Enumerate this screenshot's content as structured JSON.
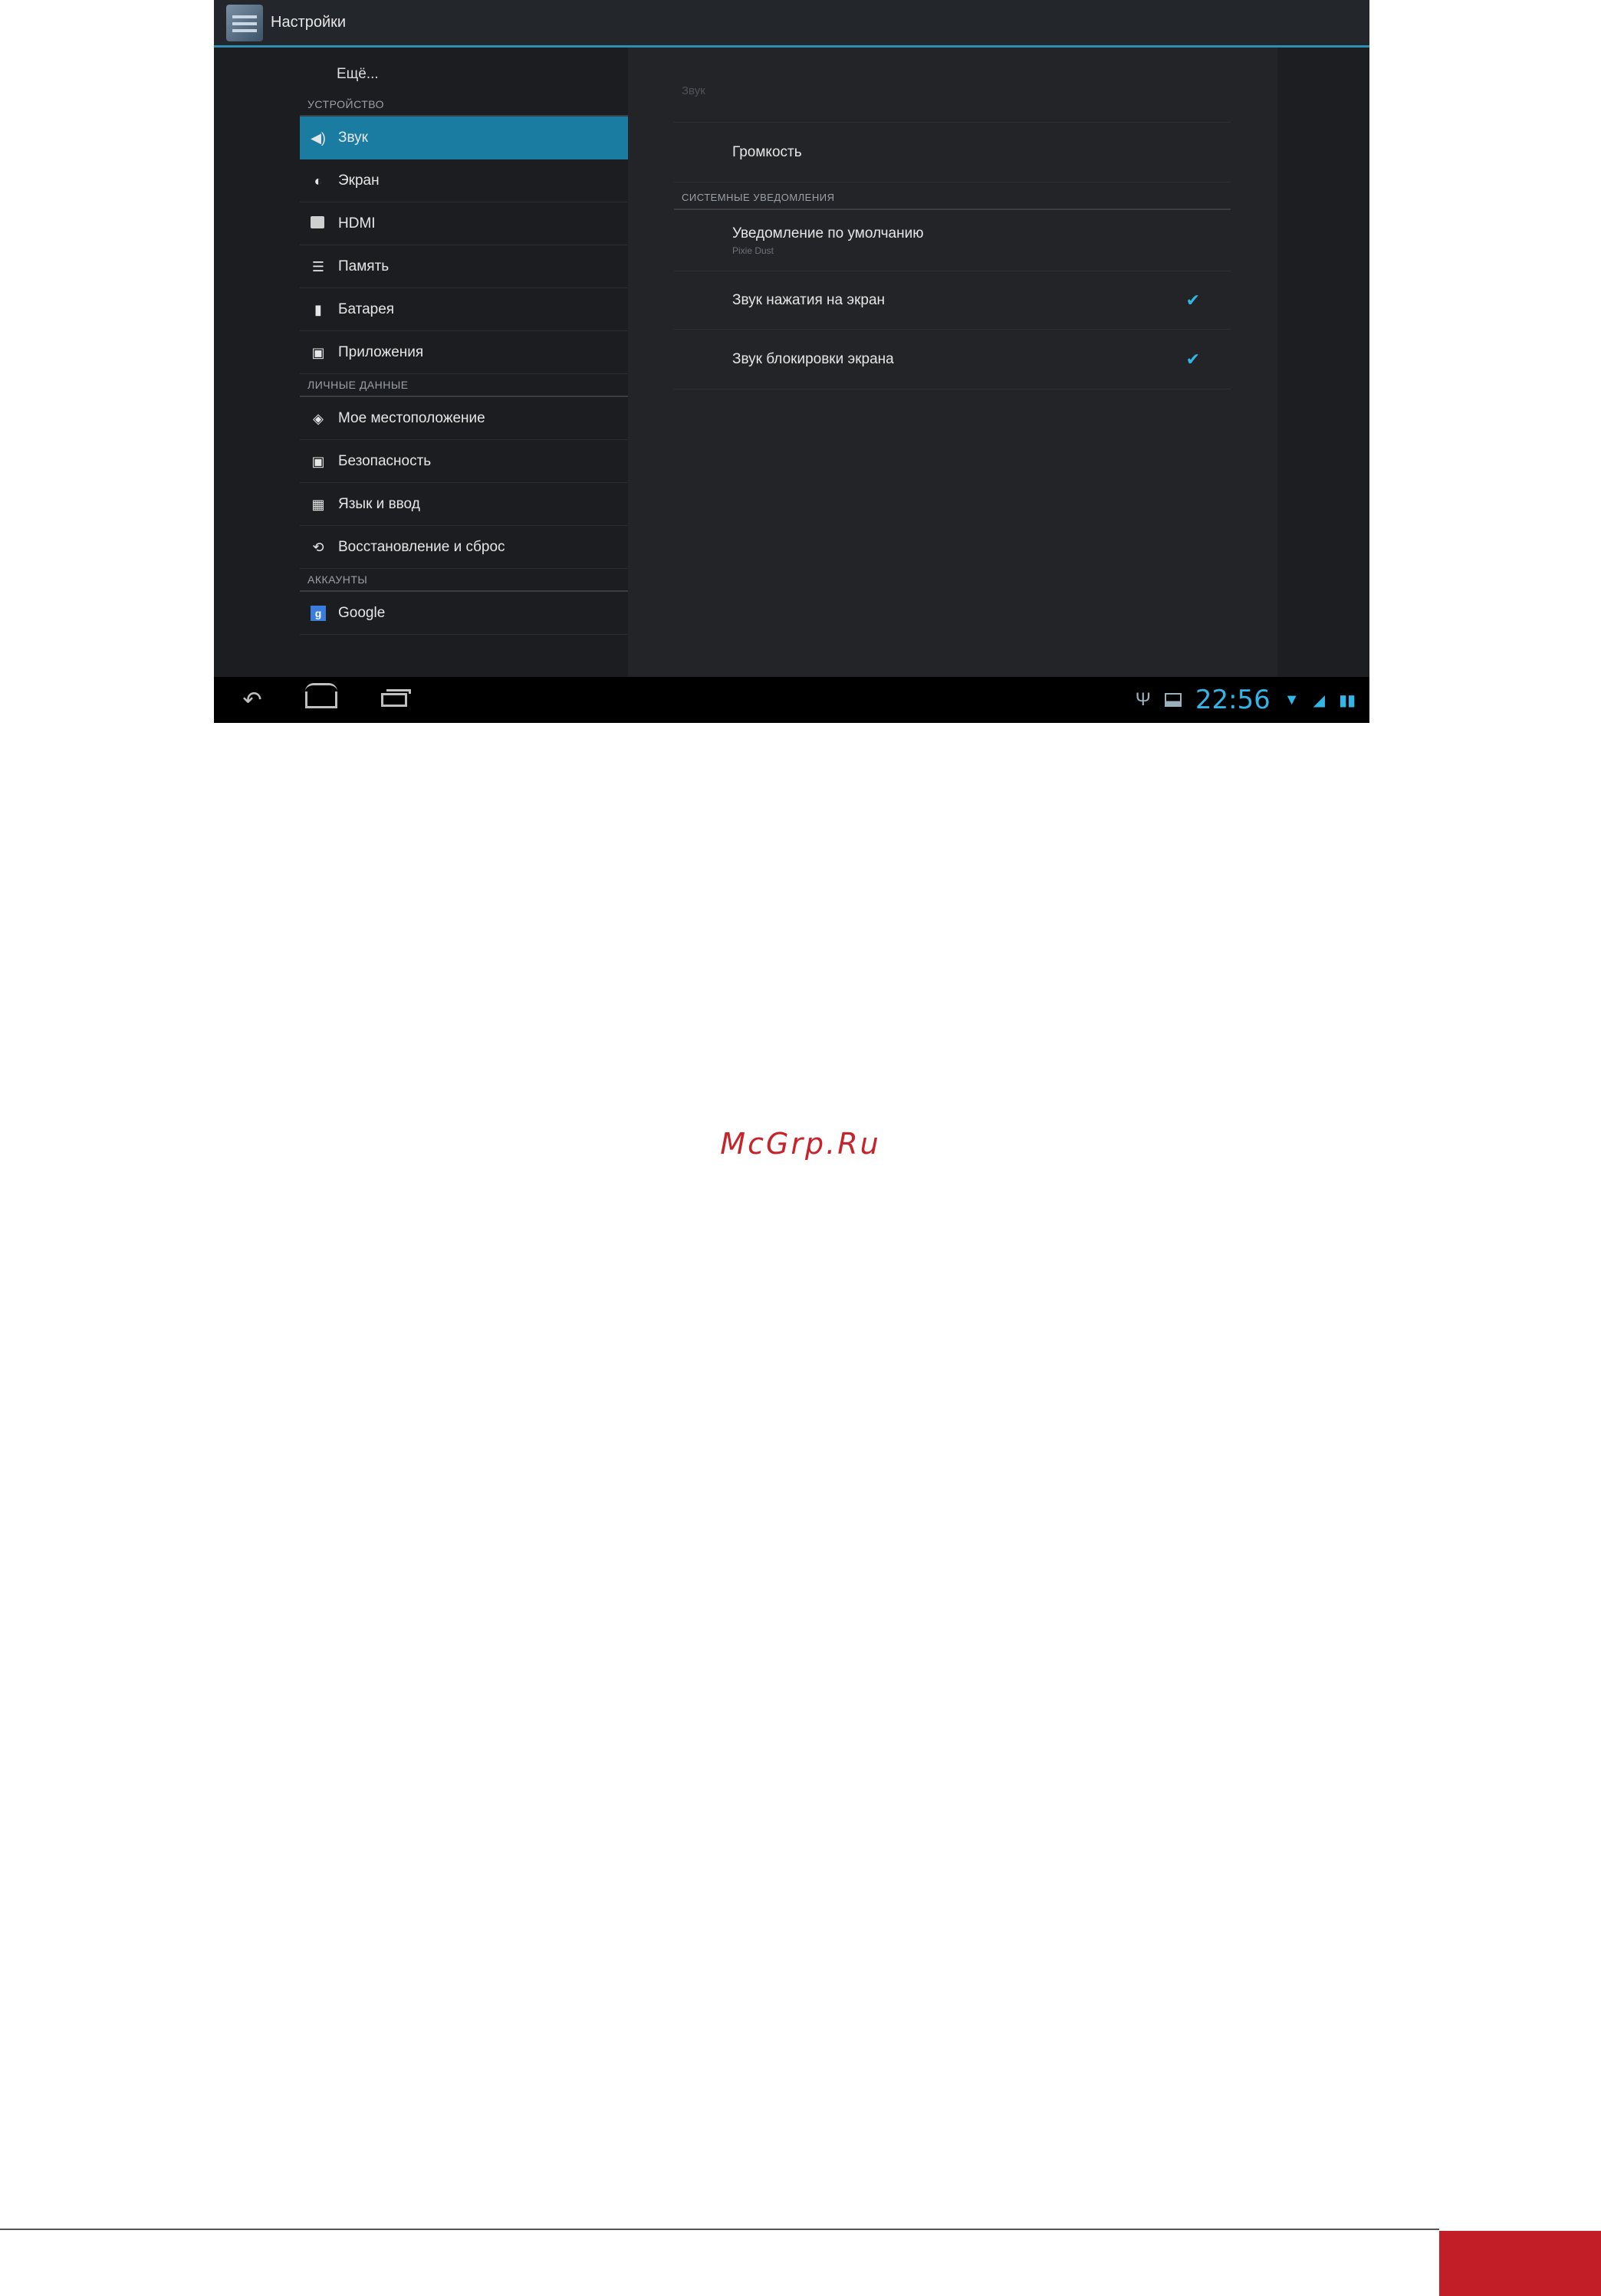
{
  "app_title": "Настройки",
  "left": {
    "more": "Ещё...",
    "section_device": "УСТРОЙСТВО",
    "items_device": [
      {
        "label": "Звук",
        "icon": "speaker-icon"
      },
      {
        "label": "Экран",
        "icon": "brightness-icon"
      },
      {
        "label": "HDMI",
        "icon": "hdmi-icon"
      },
      {
        "label": "Память",
        "icon": "storage-icon"
      },
      {
        "label": "Батарея",
        "icon": "battery-icon"
      },
      {
        "label": "Приложения",
        "icon": "apps-icon"
      }
    ],
    "section_personal": "ЛИЧНЫЕ ДАННЫЕ",
    "items_personal": [
      {
        "label": "Мое местоположение",
        "icon": "location-icon"
      },
      {
        "label": "Безопасность",
        "icon": "lock-icon"
      },
      {
        "label": "Язык и ввод",
        "icon": "keyboard-icon"
      },
      {
        "label": "Восстановление и сброс",
        "icon": "restore-icon"
      }
    ],
    "section_accounts": "АККАУНТЫ",
    "items_accounts": [
      {
        "label": "Google",
        "icon": "google-icon"
      }
    ]
  },
  "right": {
    "title": "Звук",
    "volume": "Громкость",
    "section_notifications": "СИСТЕМНЫЕ УВЕДОМЛЕНИЯ",
    "default_notification": "Уведомление по умолчанию",
    "default_notification_value": "Pixie Dust",
    "touch_sounds": "Звук нажатия на экран",
    "lock_sound": "Звук блокировки экрана"
  },
  "status_bar": {
    "time": "22:56"
  },
  "watermark": "McGrp.Ru",
  "colors": {
    "accent": "#33b5e5",
    "selected": "#1a7ca0",
    "footer": "#c21e27"
  }
}
